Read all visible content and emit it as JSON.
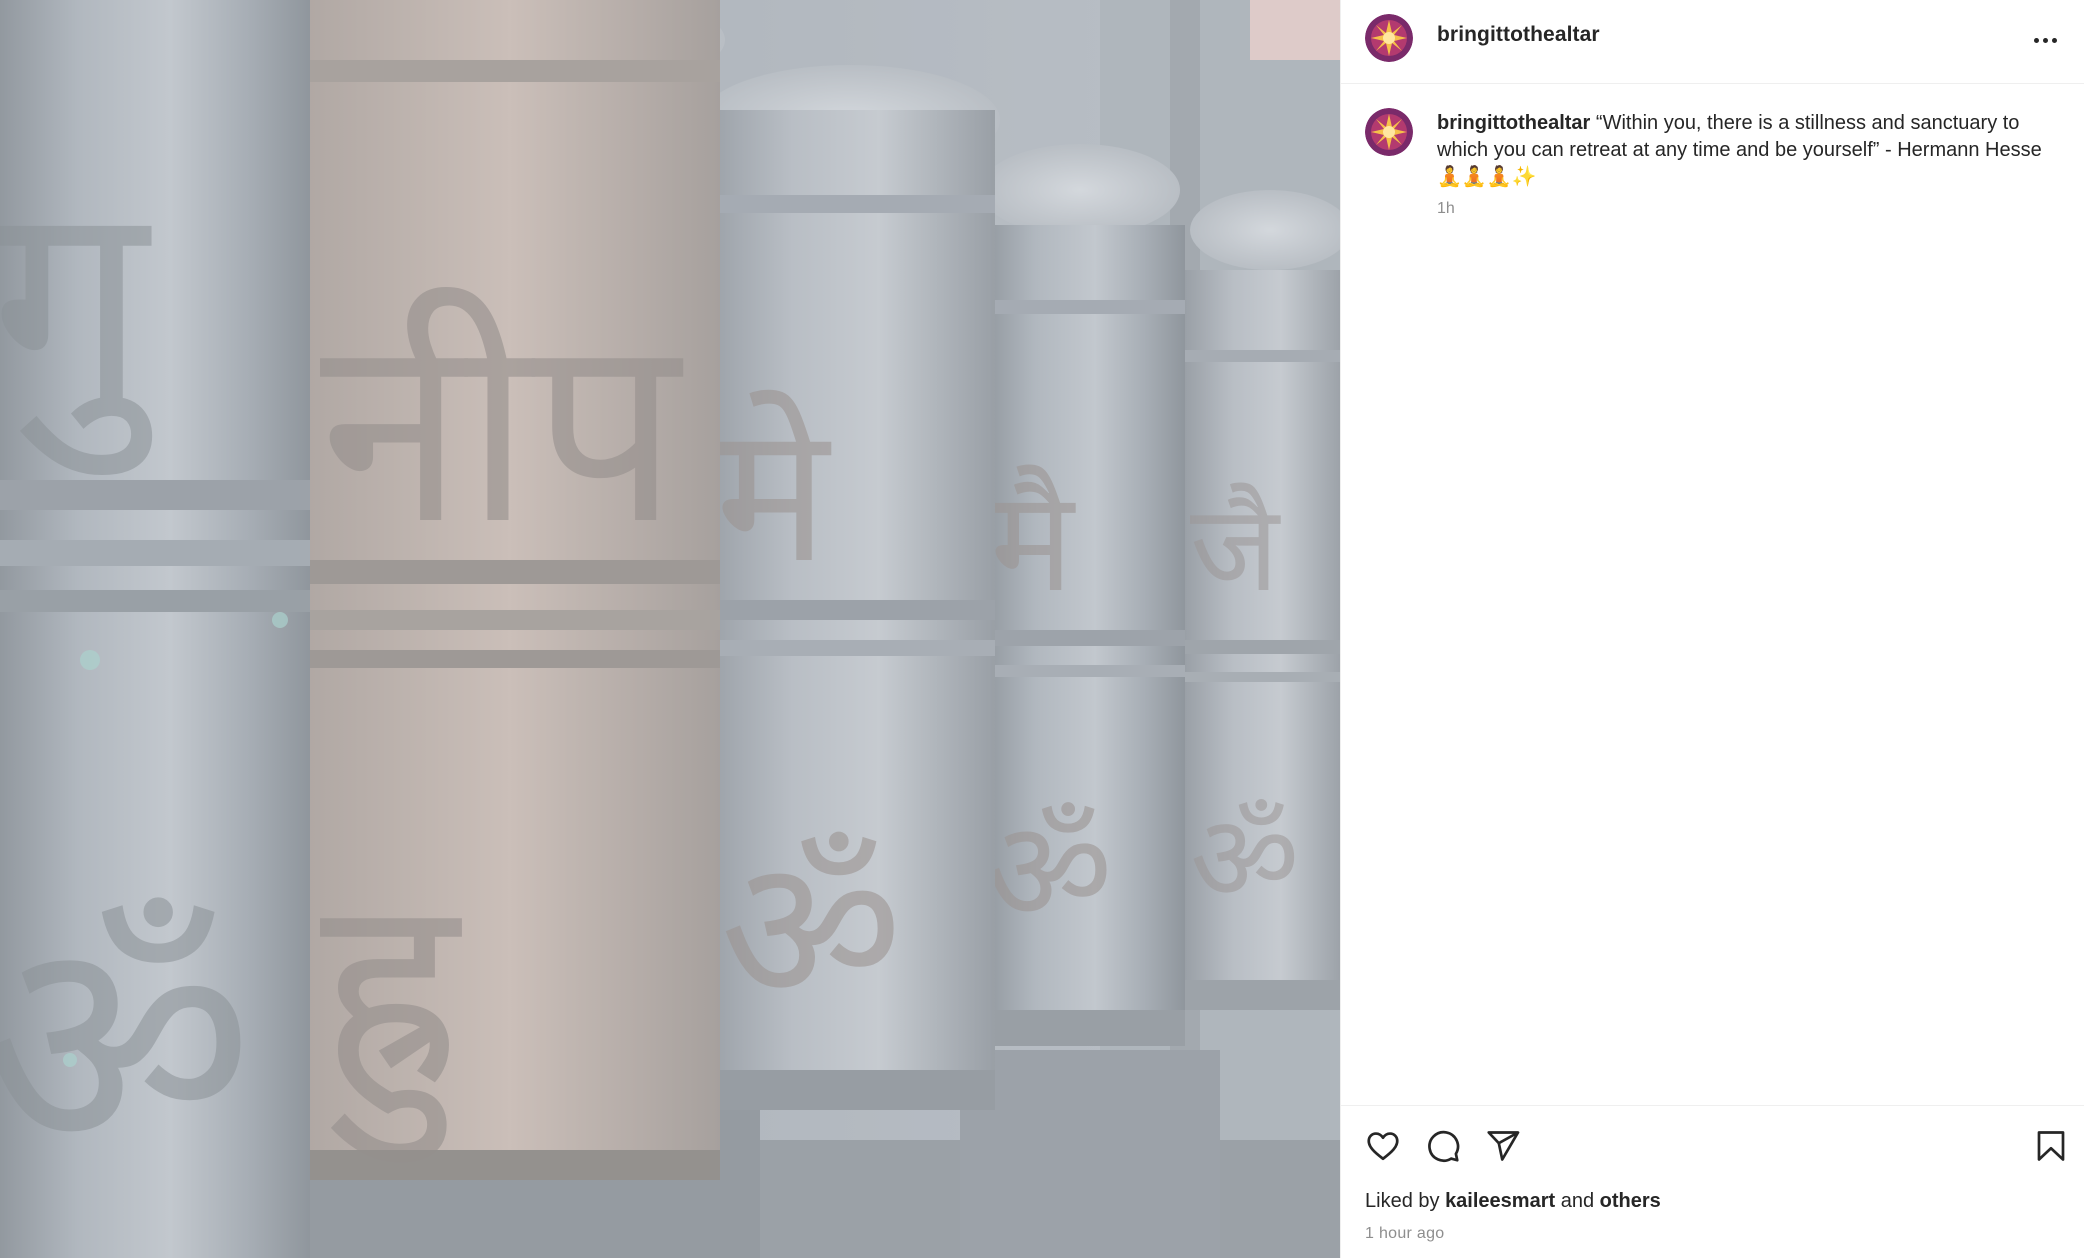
{
  "post": {
    "username": "bringittothealtar",
    "more_icon": "more-horizontal-icon",
    "media_description_icon": "photo-icon"
  },
  "caption": {
    "username": "bringittothealtar",
    "text": "“Within you, there is a stillness and sanctuary to which you can retreat at any time and be yourself” - Hermann Hesse 🧘🧘🧘✨",
    "time": "1h"
  },
  "actions": {
    "like_icon": "heart-icon",
    "comment_icon": "comment-icon",
    "share_icon": "send-icon",
    "save_icon": "bookmark-icon"
  },
  "likes": {
    "prefix": "Liked by",
    "user": "kaileesmart",
    "conjunction": "and",
    "others": "others"
  },
  "posted_time": "1 hour ago",
  "colors": {
    "text": "#262626",
    "muted": "#8e8e8e",
    "divider": "#efefef"
  }
}
